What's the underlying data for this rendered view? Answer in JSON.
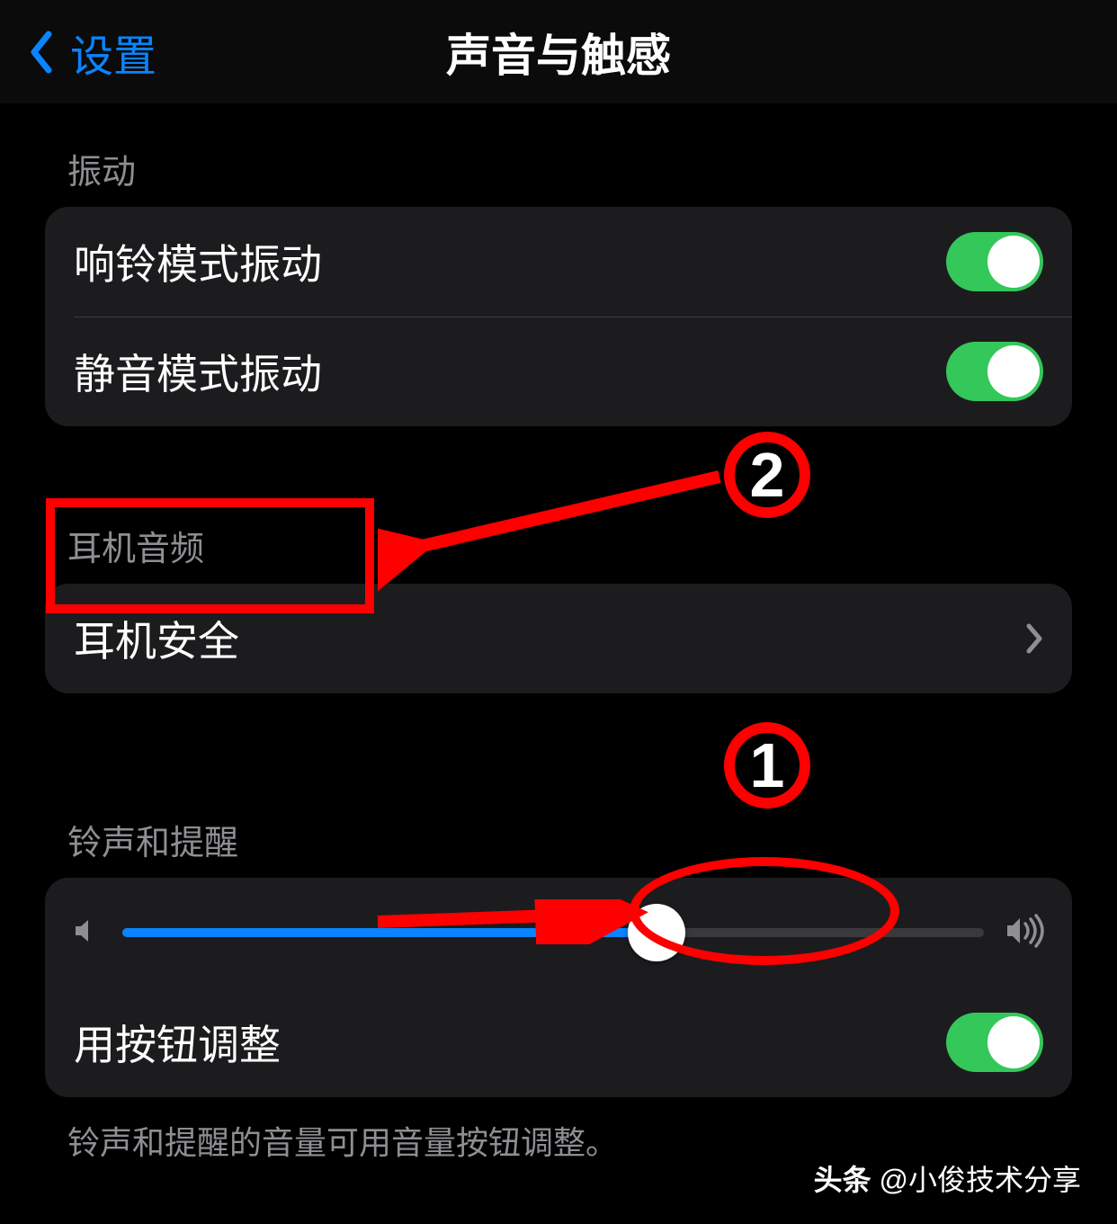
{
  "nav": {
    "back_label": "设置",
    "title": "声音与触感"
  },
  "sections": {
    "vibration": {
      "header": "振动",
      "rows": {
        "ring_vibrate": {
          "label": "响铃模式振动",
          "on": true
        },
        "silent_vibrate": {
          "label": "静音模式振动",
          "on": true
        }
      }
    },
    "headphone": {
      "header": "耳机音频",
      "rows": {
        "safety": {
          "label": "耳机安全"
        }
      }
    },
    "ringer": {
      "header": "铃声和提醒",
      "slider_percent": 62,
      "rows": {
        "change_with_buttons": {
          "label": "用按钮调整",
          "on": true
        }
      },
      "footer": "铃声和提醒的音量可用音量按钮调整。"
    }
  },
  "annotations": {
    "marker1": "1",
    "marker2": "2"
  },
  "watermark": {
    "brand": "头条",
    "user": "@小俊技术分享"
  }
}
